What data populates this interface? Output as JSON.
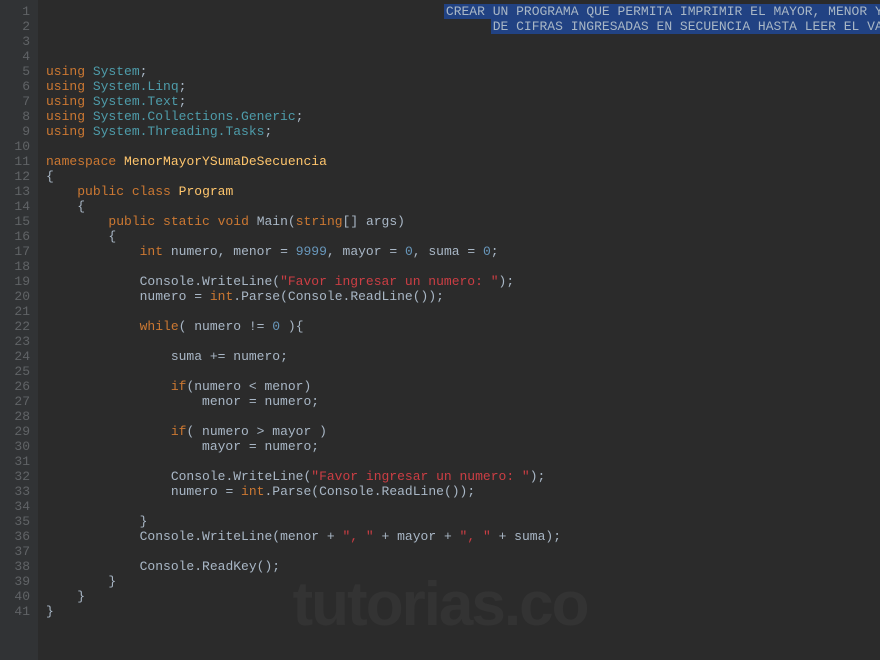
{
  "lineCount": 41,
  "watermark": "tutorias.co",
  "comment": {
    "line1": "CREAR UN PROGRAMA QUE PERMITA IMPRIMIR EL MAYOR, MENOR Y LA SUMA",
    "line2": "DE CIFRAS INGRESADAS EN SECUENCIA HASTA LEER EL VALOR CERO"
  },
  "code": {
    "using": "using",
    "system": "System",
    "systemLinq": "System.Linq",
    "systemText": "System.Text",
    "systemCollections": "System.Collections.Generic",
    "systemThreading": "System.Threading.Tasks",
    "namespace": "namespace",
    "nsName": "MenorMayorYSumaDeSecuencia",
    "public": "public",
    "class": "class",
    "program": "Program",
    "static": "static",
    "void": "void",
    "main": "Main",
    "string": "string",
    "args": "args",
    "int": "int",
    "numero": "numero",
    "menor": "menor",
    "mayor": "mayor",
    "suma": "suma",
    "n9999": "9999",
    "n0": "0",
    "console": "Console",
    "writeLine": "WriteLine",
    "favorMsg": "\"Favor ingresar un numero: \"",
    "parse": "Parse",
    "readLine": "ReadLine",
    "while": "while",
    "if": "if",
    "sep": "\", \"",
    "readKey": "ReadKey"
  }
}
